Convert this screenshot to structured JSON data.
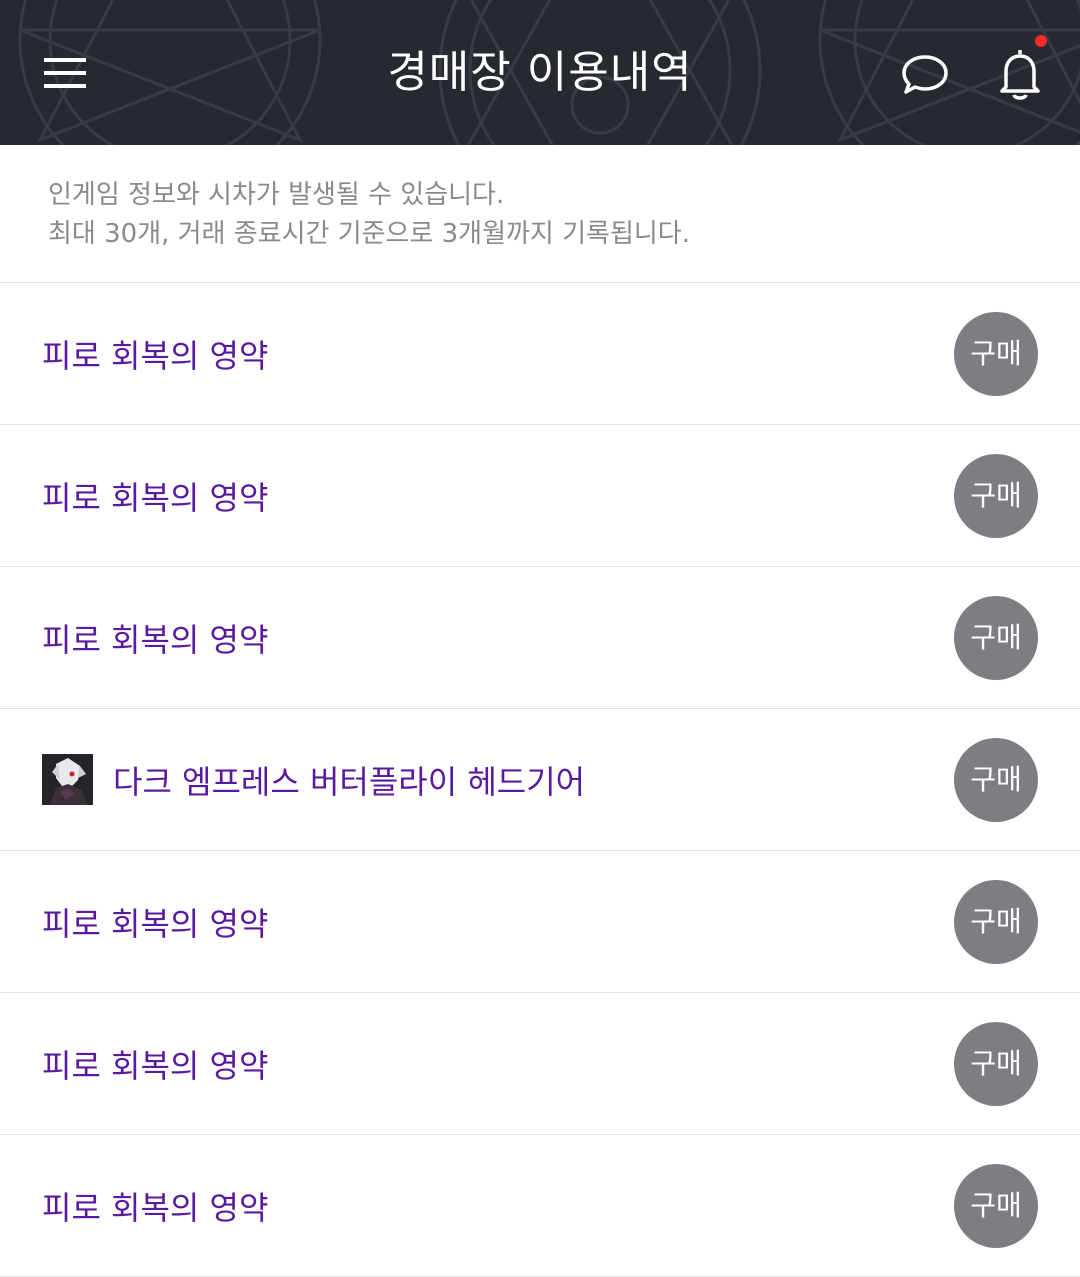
{
  "header": {
    "title": "경매장 이용내역",
    "menu_icon": "hamburger-menu-icon",
    "chat_icon": "chat-bubble-icon",
    "bell_icon": "bell-icon",
    "has_notification": true
  },
  "notice": {
    "line1": "인게임 정보와 시차가 발생될 수 있습니다.",
    "line2": "최대 30개, 거래 종료시간 기준으로 3개월까지 기록됩니다."
  },
  "colors": {
    "header_bg": "#262930",
    "item_text": "#5a1aa0",
    "buy_button_bg": "#7d7e84",
    "notification_dot": "#ff2a2a"
  },
  "items": [
    {
      "name": "피로 회복의 영약",
      "has_thumb": false,
      "action": "구매"
    },
    {
      "name": "피로 회복의 영약",
      "has_thumb": false,
      "action": "구매"
    },
    {
      "name": "피로 회복의 영약",
      "has_thumb": false,
      "action": "구매"
    },
    {
      "name": "다크 엠프레스 버터플라이 헤드기어",
      "has_thumb": true,
      "thumb_icon": "character-avatar-icon",
      "action": "구매"
    },
    {
      "name": "피로 회복의 영약",
      "has_thumb": false,
      "action": "구매"
    },
    {
      "name": "피로 회복의 영약",
      "has_thumb": false,
      "action": "구매"
    },
    {
      "name": "피로 회복의 영약",
      "has_thumb": false,
      "action": "구매"
    }
  ]
}
